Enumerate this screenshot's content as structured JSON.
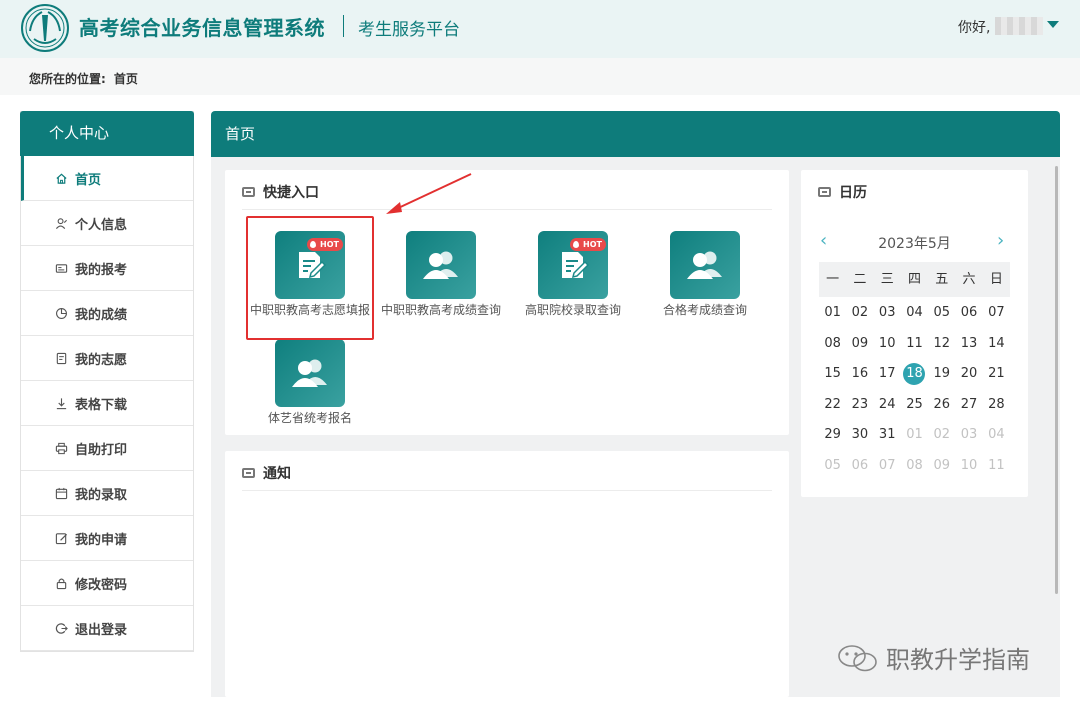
{
  "header": {
    "title": "高考综合业务信息管理系统",
    "subtitle": "考生服务平台",
    "greeting": "你好,"
  },
  "breadcrumb": {
    "label": "您所在的位置:",
    "current": "首页"
  },
  "sidebar": {
    "title": "个人中心",
    "items": [
      {
        "label": "首页",
        "icon": "home-icon",
        "active": true
      },
      {
        "label": "个人信息",
        "icon": "user-icon"
      },
      {
        "label": "我的报考",
        "icon": "id-card-icon"
      },
      {
        "label": "我的成绩",
        "icon": "pie-chart-icon"
      },
      {
        "label": "我的志愿",
        "icon": "document-icon"
      },
      {
        "label": "表格下载",
        "icon": "download-icon"
      },
      {
        "label": "自助打印",
        "icon": "printer-icon"
      },
      {
        "label": "我的录取",
        "icon": "calendar-icon"
      },
      {
        "label": "我的申请",
        "icon": "edit-icon"
      },
      {
        "label": "修改密码",
        "icon": "lock-icon"
      },
      {
        "label": "退出登录",
        "icon": "logout-icon"
      }
    ]
  },
  "main": {
    "title": "首页",
    "quick": {
      "title": "快捷入口",
      "tiles": [
        {
          "label": "中职职教高考志愿填报",
          "icon": "form-edit-icon",
          "hot": "HOT"
        },
        {
          "label": "中职职教高考成绩查询",
          "icon": "users-icon"
        },
        {
          "label": "高职院校录取查询",
          "icon": "form-edit-icon",
          "hot": "HOT"
        },
        {
          "label": "合格考成绩查询",
          "icon": "users-icon"
        },
        {
          "label": "体艺省统考报名",
          "icon": "users-icon"
        }
      ]
    },
    "notice": {
      "title": "通知"
    },
    "calendar": {
      "title": "日历",
      "month_label": "2023年5月",
      "weekdays": [
        "一",
        "二",
        "三",
        "四",
        "五",
        "六",
        "日"
      ],
      "days": [
        "01",
        "02",
        "03",
        "04",
        "05",
        "06",
        "07",
        "08",
        "09",
        "10",
        "11",
        "12",
        "13",
        "14",
        "15",
        "16",
        "17",
        "18",
        "19",
        "20",
        "21",
        "22",
        "23",
        "24",
        "25",
        "26",
        "27",
        "28",
        "29",
        "30",
        "31",
        "01",
        "02",
        "03",
        "04",
        "05",
        "06",
        "07",
        "08",
        "09",
        "10",
        "11"
      ],
      "today_index": 17,
      "other_month_from": 31
    }
  },
  "watermark": "职教升学指南",
  "colors": {
    "primary": "#0e7c7b",
    "accent": "#2ea3b0",
    "highlight": "#e23030",
    "hot": "#e84a4a"
  }
}
